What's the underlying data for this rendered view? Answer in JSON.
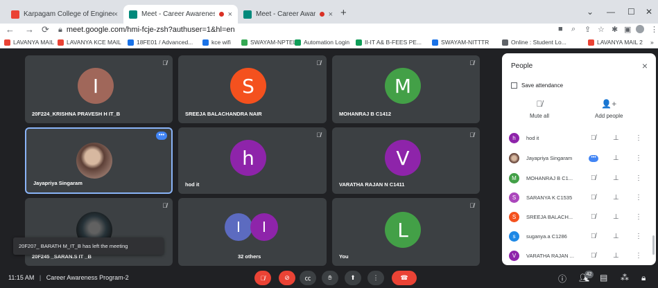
{
  "browser": {
    "tabs": [
      {
        "title": "Karpagam College of Engineering",
        "close": "×",
        "recording": false
      },
      {
        "title": "Meet - Career Awareness Pro",
        "close": "×",
        "recording": true
      },
      {
        "title": "Meet - Career Awareness Pro",
        "close": "×",
        "recording": true
      }
    ],
    "new_tab": "+",
    "window": {
      "minimize": "—",
      "maximize": "☐",
      "close": "✕",
      "chevron": "⌄"
    },
    "nav": {
      "back": "←",
      "forward": "→",
      "reload": "⟳"
    },
    "url": "meet.google.com/hmi-fcje-zsh?authuser=1&hl=en",
    "bookmarks": [
      {
        "label": "LAVANYA MAIL",
        "color": "#ea4335"
      },
      {
        "label": "LAVANYA KCE MAIL",
        "color": "#ea4335"
      },
      {
        "label": "18FE01 / Advanced...",
        "color": "#1a73e8"
      },
      {
        "label": "kce wifi",
        "color": "#1a73e8"
      },
      {
        "label": "SWAYAM-NPTEL",
        "color": "#34a853"
      },
      {
        "label": "Automation Login",
        "color": "#0f9d58"
      },
      {
        "label": "II-IT A& B-FEES PE...",
        "color": "#0f9d58"
      },
      {
        "label": "SWAYAM-NITTTR",
        "color": "#1a73e8"
      },
      {
        "label": "Online : Student Lo...",
        "color": "#5f6368"
      },
      {
        "label": "LAVANYA MAIL 2",
        "color": "#ea4335"
      }
    ],
    "bookmarks_more": "»"
  },
  "tiles": [
    {
      "name": "20F224_KRISHNA PRAVESH H IT_B",
      "initial": "I",
      "color": "#a0675a",
      "muted": true
    },
    {
      "name": "SREEJA BALACHANDRA NAIR",
      "initial": "S",
      "color": "#f4511e",
      "muted": true
    },
    {
      "name": "MOHANRAJ B C1412",
      "initial": "M",
      "color": "#43a047",
      "muted": true
    },
    {
      "name": "Jayapriya Singaram",
      "initial": "",
      "color": "#8d6e63",
      "muted": false
    },
    {
      "name": "hod it",
      "initial": "h",
      "color": "#8e24aa",
      "muted": true
    },
    {
      "name": "VARATHA RAJAN N C1411",
      "initial": "V",
      "color": "#8e24aa",
      "muted": true
    },
    {
      "name": "20F245 _SARAN.S IT _B",
      "initial": "",
      "color": "#263238",
      "muted": true
    },
    {
      "name": "32 others",
      "initials": [
        "I",
        "I"
      ],
      "colors": [
        "#5c6bc0",
        "#8e24aa"
      ],
      "muted": false
    },
    {
      "name": "You",
      "initial": "L",
      "color": "#43a047",
      "muted": false
    }
  ],
  "toast": "20F207_ BARATH M_IT_B has left the meeting",
  "people_panel": {
    "title": "People",
    "close": "×",
    "save_attendance": "Save attendance",
    "mute_all": "Mute all",
    "add_people": "Add people",
    "participants": [
      {
        "name": "hod it",
        "initial": "h",
        "color": "#8e24aa"
      },
      {
        "name": "Jayapriya Singaram",
        "initial": "",
        "color": "#8d6e63",
        "more": "•••"
      },
      {
        "name": "MOHANRAJ B C1...",
        "initial": "M",
        "color": "#43a047"
      },
      {
        "name": "SARANYA K C1535",
        "initial": "S",
        "color": "#ab47bc"
      },
      {
        "name": "SREEJA BALACH...",
        "initial": "S",
        "color": "#f4511e"
      },
      {
        "name": "suganya.a C1286",
        "initial": "s",
        "color": "#1e88e5"
      },
      {
        "name": "VARATHA RAJAN ...",
        "initial": "V",
        "color": "#8e24aa"
      }
    ]
  },
  "bottom": {
    "time": "11:15 AM",
    "separator": "|",
    "meeting_name": "Career Awareness Program-2",
    "participant_count": "42"
  }
}
